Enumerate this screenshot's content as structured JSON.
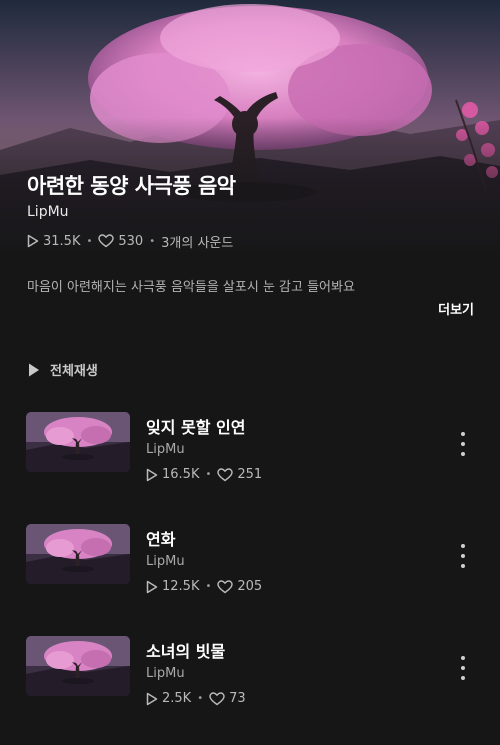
{
  "playlist": {
    "title": "아련한 동양 사극풍 음악",
    "artist": "LipMu",
    "plays": "31.5K",
    "likes": "530",
    "sound_count": "3개의 사운드",
    "description": "마음이 아련해지는 사극풍 음악들을 살포시 눈 감고 들어봐요",
    "more_label": "더보기",
    "play_all_label": "전체재생"
  },
  "tracks": [
    {
      "title": "잊지 못할 인연",
      "artist": "LipMu",
      "plays": "16.5K",
      "likes": "251"
    },
    {
      "title": "연화",
      "artist": "LipMu",
      "plays": "12.5K",
      "likes": "205"
    },
    {
      "title": "소녀의 빗물",
      "artist": "LipMu",
      "plays": "2.5K",
      "likes": "73"
    }
  ],
  "icons": {
    "play": "play-icon",
    "like": "heart-icon",
    "more": "more-vertical-icon"
  },
  "colors": {
    "background": "#161616",
    "blossom": "#d77fbf",
    "text_secondary": "#b3b3b3"
  }
}
